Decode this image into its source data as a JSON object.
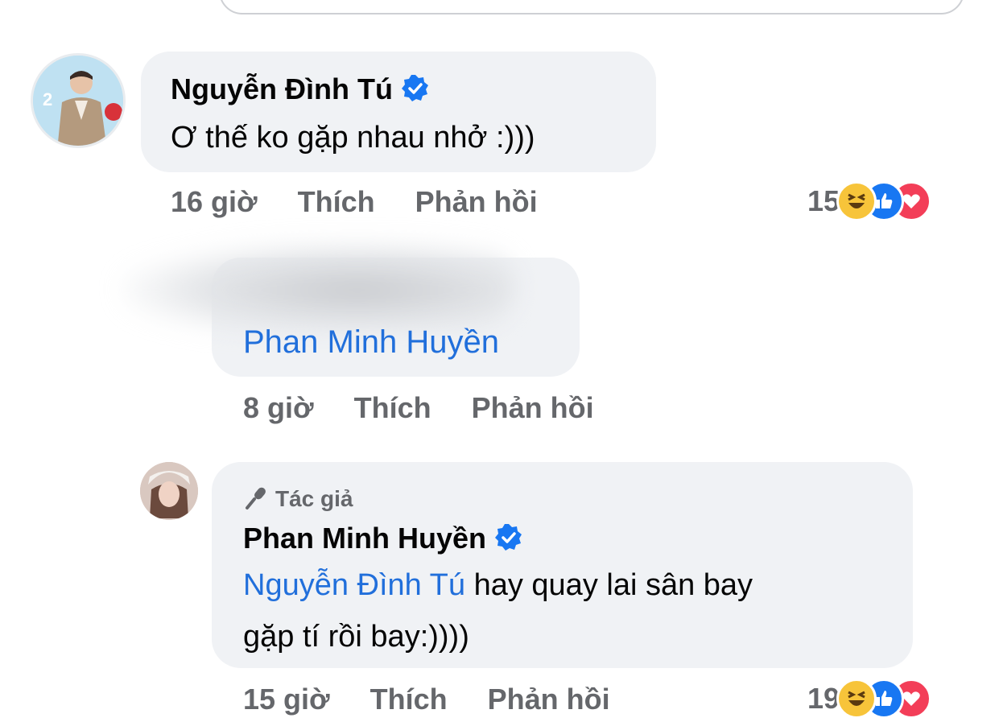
{
  "comments": [
    {
      "author": "Nguyễn Đình Tú",
      "verified": true,
      "text": "Ơ thế ko gặp nhau nhở :)))",
      "time": "16 giờ",
      "like_label": "Thích",
      "reply_label": "Phản hồi",
      "reaction_count": "15",
      "reactions": [
        "haha",
        "like",
        "love"
      ]
    },
    {
      "author": "",
      "mention": "Phan Minh Huyền",
      "time": "8 giờ",
      "like_label": "Thích",
      "reply_label": "Phản hồi"
    },
    {
      "badge": "Tác giả",
      "author": "Phan Minh Huyền",
      "verified": true,
      "mention": "Nguyễn Đình Tú",
      "text_line1": " hay quay lai sân bay",
      "text_line2": "gặp tí rồi bay:))))",
      "time": "15 giờ",
      "like_label": "Thích",
      "reply_label": "Phản hồi",
      "reaction_count": "19",
      "reactions": [
        "haha",
        "like",
        "love"
      ]
    }
  ],
  "colors": {
    "bubble": "#f0f2f5",
    "link": "#216fdb",
    "meta": "#65676b",
    "verified": "#1877f2"
  }
}
